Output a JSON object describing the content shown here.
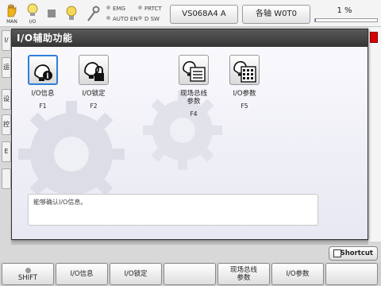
{
  "topbar": {
    "man_label": "MAN",
    "io_label": "I/O",
    "indicators": [
      "EMG",
      "PRTCT",
      "AUTO EN",
      "D SW"
    ],
    "program_button": "VS068A4 A",
    "axis_button": "各轴 W0T0",
    "speed_percent": "1 %",
    "speed_value": 1
  },
  "background": {
    "left_tabs": [
      "I/",
      "运",
      "设",
      "控",
      "E",
      ""
    ]
  },
  "dialog": {
    "title": "I/O辅助功能",
    "functions": [
      {
        "label": "I/O信息",
        "key": "F1",
        "icon": "io-info-icon",
        "selected": true
      },
      {
        "label": "I/O锁定",
        "key": "F2",
        "icon": "io-lock-icon",
        "selected": false
      },
      {
        "label": "现场总线\n参数",
        "key": "F4",
        "icon": "fieldbus-params-icon",
        "selected": false
      },
      {
        "label": "I/O参数",
        "key": "F5",
        "icon": "io-params-icon",
        "selected": false
      }
    ],
    "message": "能够确认I/O信息。"
  },
  "shortcut_label": "Shortcut",
  "function_keys": [
    {
      "label": "SHIFT"
    },
    {
      "label": "I/O信息"
    },
    {
      "label": "I/O锁定"
    },
    {
      "label": ""
    },
    {
      "label": "现场总线\n参数"
    },
    {
      "label": "I/O参数"
    },
    {
      "label": ""
    }
  ],
  "colors": {
    "title_bar": "#3a3a3a",
    "selected_border": "#2f7fd8",
    "progress": "#3a6fc4",
    "alert": "#d80000"
  }
}
